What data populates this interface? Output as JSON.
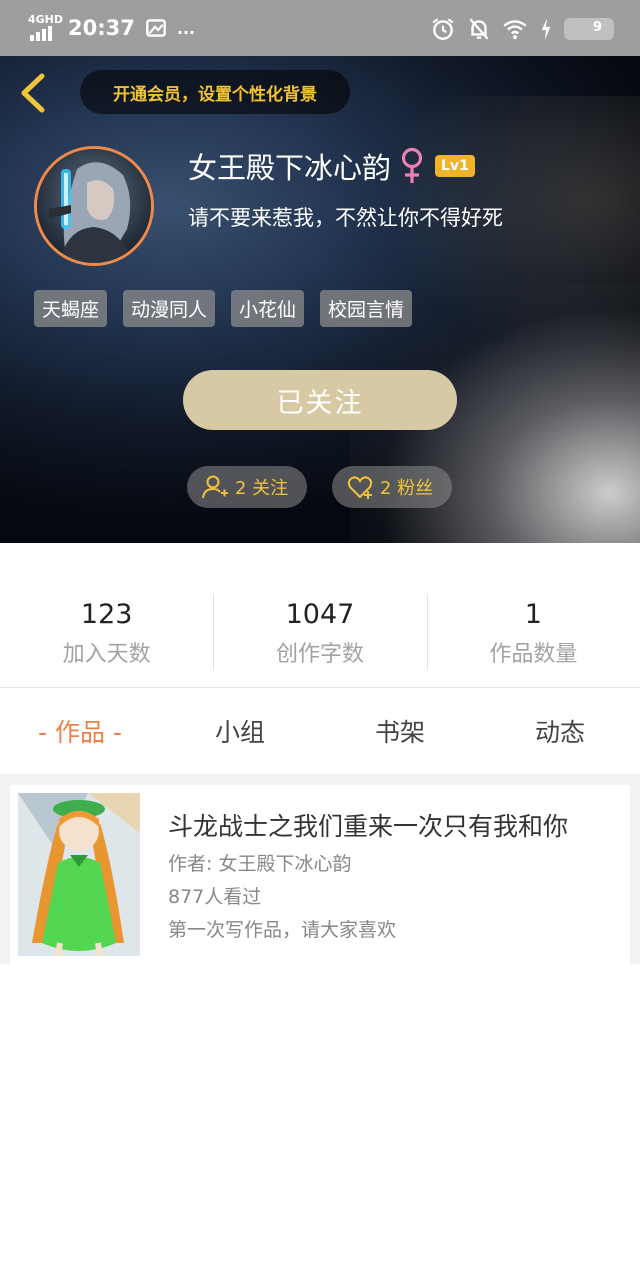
{
  "status_bar": {
    "network": "4GHD",
    "time": "20:37",
    "extra": "...",
    "battery": "9",
    "icons": [
      "signal-icon",
      "photo-icon",
      "alarm-icon",
      "mute-icon",
      "wifi-icon",
      "charging-icon",
      "battery-icon"
    ]
  },
  "header": {
    "vip_banner": "开通会员，设置个性化背景",
    "nickname": "女王殿下冰心韵",
    "level": "Lv1",
    "signature": "请不要来惹我，不然让你不得好死",
    "tags": [
      "天蝎座",
      "动漫同人",
      "小花仙",
      "校园言情"
    ],
    "follow_button": "已关注",
    "following": "2 关注",
    "fans": "2 粉丝"
  },
  "stats": [
    {
      "value": "123",
      "label": "加入天数"
    },
    {
      "value": "1047",
      "label": "创作字数"
    },
    {
      "value": "1",
      "label": "作品数量"
    }
  ],
  "tabs": [
    "- 作品 -",
    "小组",
    "书架",
    "动态"
  ],
  "works": [
    {
      "title": "斗龙战士之我们重来一次只有我和你",
      "author": "作者: 女王殿下冰心韵",
      "views": "877人看过",
      "description": "第一次写作品，请大家喜欢"
    }
  ],
  "colors": {
    "accent": "#ef7e4a",
    "gold": "#f0c23b",
    "follow_button": "#d7c9a3",
    "level_badge": "#f0b428"
  }
}
